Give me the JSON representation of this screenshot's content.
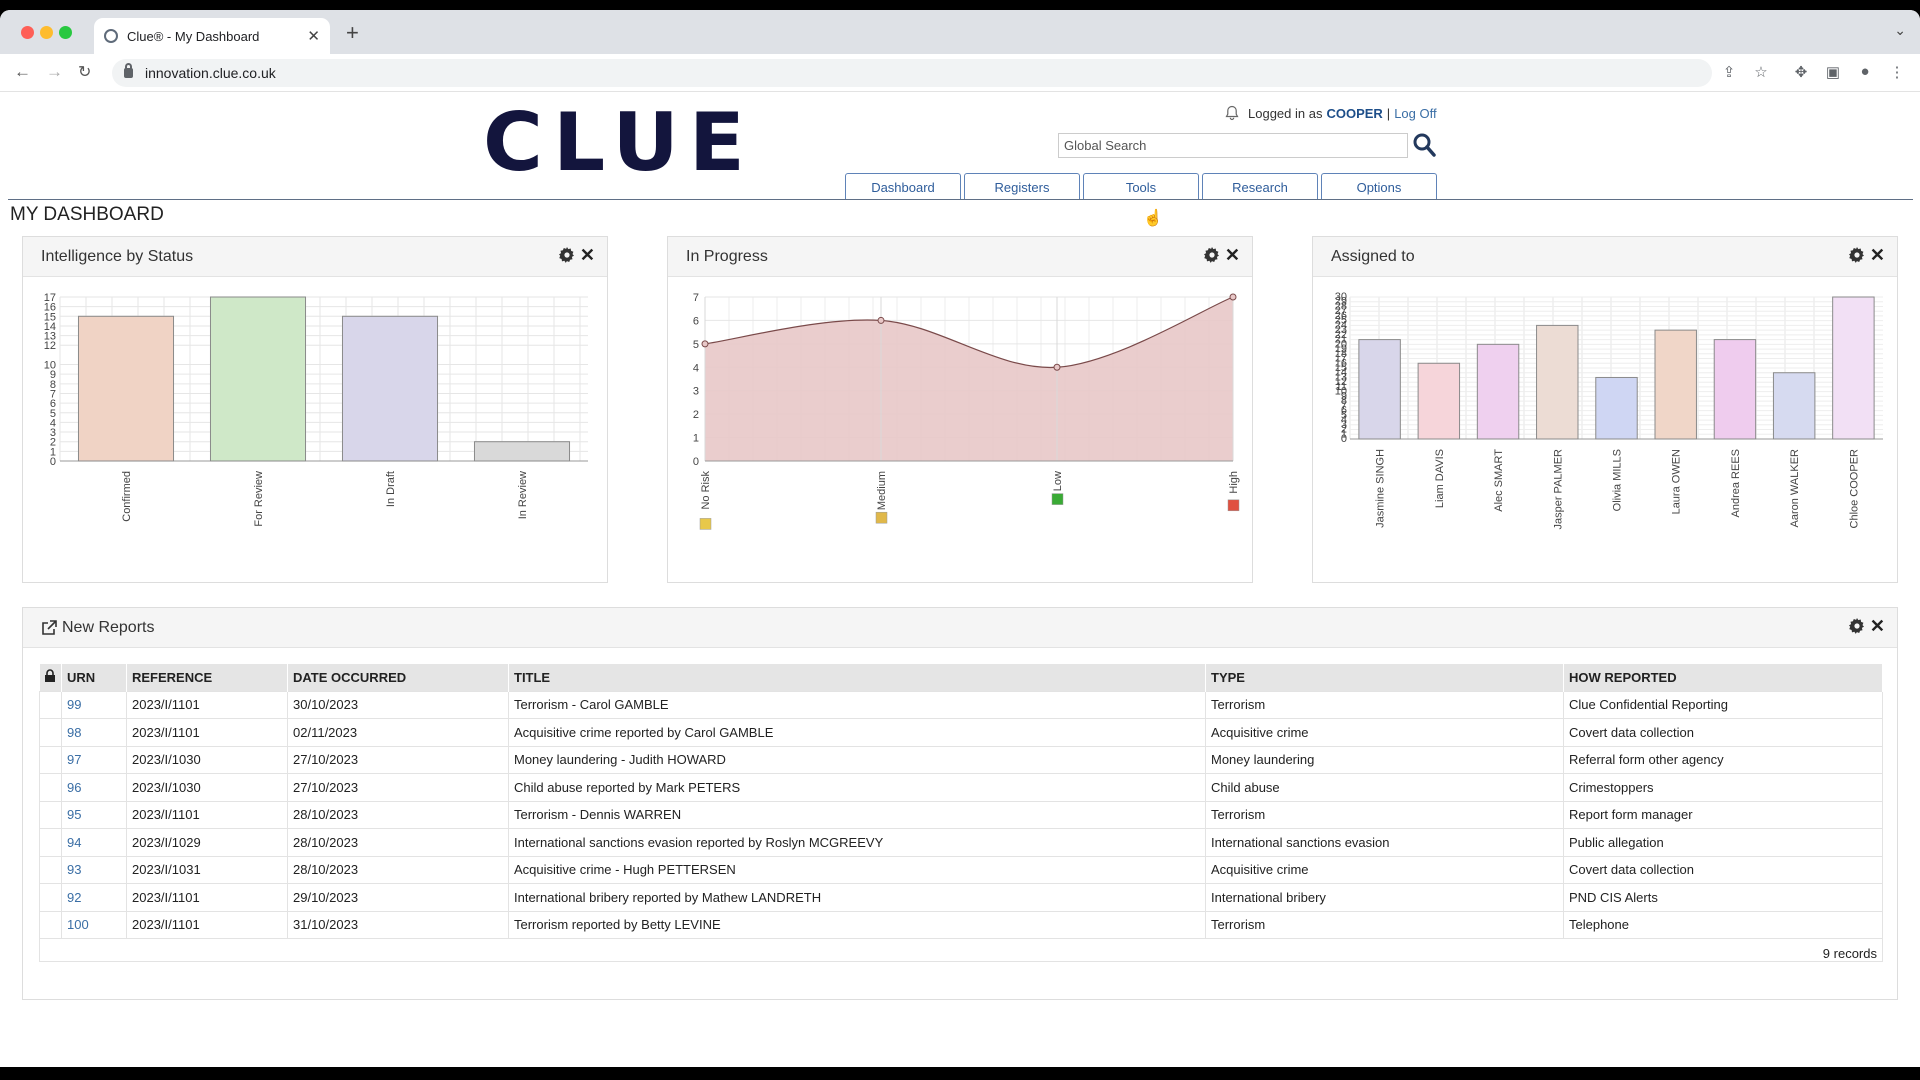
{
  "browser": {
    "tab_title": "Clue® - My Dashboard",
    "url": "innovation.clue.co.uk"
  },
  "header": {
    "logo_text": "CLUE",
    "logged_in_prefix": "Logged in as",
    "user": "COOPER",
    "separator": "|",
    "logoff": "Log Off",
    "search_placeholder": "Global Search"
  },
  "nav": {
    "tabs": [
      "Dashboard",
      "Registers",
      "Tools",
      "Research",
      "Options"
    ]
  },
  "page_title": "MY DASHBOARD",
  "widgets": {
    "status_title": "Intelligence by Status",
    "progress_title": "In Progress",
    "assigned_title": "Assigned to"
  },
  "chart_data": [
    {
      "type": "bar",
      "title": "Intelligence by Status",
      "categories": [
        "Confirmed",
        "For Review",
        "In Draft",
        "In Review"
      ],
      "values": [
        15,
        17,
        15,
        2
      ],
      "colors": [
        "#f0d3c5",
        "#cfe8c8",
        "#d8d6ea",
        "#d9d9d9"
      ],
      "yticks": [
        0,
        1,
        2,
        3,
        4,
        5,
        6,
        7,
        8,
        9,
        10,
        12,
        13,
        14,
        15,
        16,
        17
      ],
      "ylim": [
        0,
        17
      ],
      "grid": true
    },
    {
      "type": "area",
      "title": "In Progress",
      "categories": [
        "No Risk",
        "Medium",
        "Low",
        "High"
      ],
      "values": [
        5,
        6,
        4,
        7
      ],
      "marker_colors": [
        "#e8c84a",
        "#e0b84a",
        "#3aaa35",
        "#e05040"
      ],
      "yticks": [
        0,
        1,
        2,
        3,
        4,
        5,
        6,
        7
      ],
      "ylim": [
        0,
        7
      ],
      "grid": true
    },
    {
      "type": "bar",
      "title": "Assigned to",
      "categories": [
        "Jasmine SINGH",
        "Liam DAVIS",
        "Alec SMART",
        "Jasper PALMER",
        "Olivia MILLS",
        "Laura OWEN",
        "Andrea REES",
        "Aaron WALKER",
        "Chloe COOPER"
      ],
      "values": [
        21,
        16,
        20,
        24,
        13,
        23,
        21,
        14,
        30
      ],
      "colors": [
        "#d8d6ea",
        "#f6d5da",
        "#efd0ef",
        "#ecdcd4",
        "#cfd6f3",
        "#f0d6c8",
        "#efccee",
        "#d6daf0",
        "#f2e0f5"
      ],
      "ylim": [
        0,
        30
      ],
      "grid": true
    }
  ],
  "reports": {
    "title": "New Reports",
    "columns": [
      "URN",
      "REFERENCE",
      "DATE OCCURRED",
      "TITLE",
      "TYPE",
      "HOW REPORTED"
    ],
    "rows": [
      [
        "99",
        "2023/I/1101",
        "30/10/2023",
        "Terrorism - Carol GAMBLE",
        "Terrorism",
        "Clue Confidential Reporting"
      ],
      [
        "98",
        "2023/I/1101",
        "02/11/2023",
        "Acquisitive crime reported by Carol GAMBLE",
        "Acquisitive crime",
        "Covert data collection"
      ],
      [
        "97",
        "2023/I/1030",
        "27/10/2023",
        "Money laundering - Judith HOWARD",
        "Money laundering",
        "Referral form other agency"
      ],
      [
        "96",
        "2023/I/1030",
        "27/10/2023",
        "Child abuse reported by Mark PETERS",
        "Child abuse",
        "Crimestoppers"
      ],
      [
        "95",
        "2023/I/1101",
        "28/10/2023",
        "Terrorism - Dennis WARREN",
        "Terrorism",
        "Report form manager"
      ],
      [
        "94",
        "2023/I/1029",
        "28/10/2023",
        "International sanctions evasion reported by Roslyn MCGREEVY",
        "International sanctions evasion",
        "Public allegation"
      ],
      [
        "93",
        "2023/I/1031",
        "28/10/2023",
        "Acquisitive crime - Hugh PETTERSEN",
        "Acquisitive crime",
        "Covert data collection"
      ],
      [
        "92",
        "2023/I/1101",
        "29/10/2023",
        "International bribery reported by Mathew LANDRETH",
        "International bribery",
        "PND CIS Alerts"
      ],
      [
        "100",
        "2023/I/1101",
        "31/10/2023",
        "Terrorism reported by Betty LEVINE",
        "Terrorism",
        "Telephone"
      ]
    ],
    "record_count": "9 records"
  }
}
